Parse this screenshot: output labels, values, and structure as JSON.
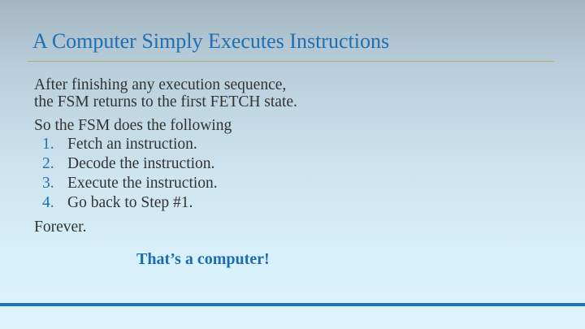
{
  "slide": {
    "title": "A Computer Simply Executes Instructions",
    "intro_line_1": "After finishing any execution sequence,",
    "intro_line_2": "the FSM returns to the first FETCH state.",
    "lead": "So the FSM does the following",
    "steps": [
      {
        "number": "1.",
        "text": "Fetch an instruction."
      },
      {
        "number": "2.",
        "text": "Decode the instruction."
      },
      {
        "number": "3.",
        "text": "Execute the instruction."
      },
      {
        "number": "4.",
        "text": "Go back to Step #1."
      }
    ],
    "closing": "Forever.",
    "punchline": "That’s a computer!"
  },
  "colors": {
    "title": "#1e6fb3",
    "body_text": "#333333",
    "rule_gold": "#b8ad6a",
    "accent_blue": "#1f72bb"
  }
}
